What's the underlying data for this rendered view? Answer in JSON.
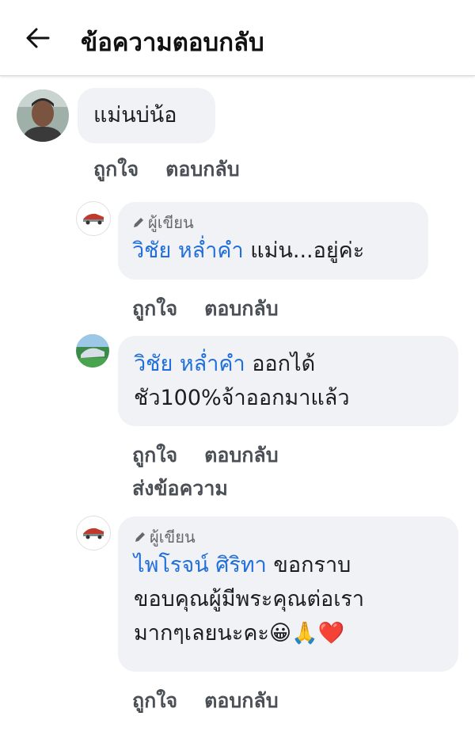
{
  "header": {
    "title": "ข้อความตอบกลับ",
    "back_icon": "arrow-left-icon"
  },
  "comments": [
    {
      "author_tag": "",
      "name": "",
      "text": "แม่นบ่น้อ",
      "actions": [
        "ถูกใจ",
        "ตอบกลับ"
      ]
    },
    {
      "author_tag": "ผู้เขียน",
      "name": "วิชัย หล่ำคำ",
      "text": " แม่น...อยู่ค่ะ",
      "actions": [
        "ถูกใจ",
        "ตอบกลับ"
      ]
    },
    {
      "author_tag": "",
      "name": "วิชัย หล่ำคำ",
      "text_line1": " ออกได้",
      "text_line2": "ชัว100%จ้าออกมาแล้ว",
      "actions": [
        "ถูกใจ",
        "ตอบกลับ"
      ],
      "extra_action": "ส่งข้อความ"
    },
    {
      "author_tag": "ผู้เขียน",
      "name": "ไพโรจน์ ศิริทา",
      "text_line1": " ขอกราบ",
      "text_line2": "ขอบคุณผู้มีพระคุณต่อเรา",
      "text_line3": "มากๆเลยนะคะ",
      "emojis": [
        "😀",
        "🙏",
        "❤️"
      ],
      "actions": [
        "ถูกใจ",
        "ตอบกลับ"
      ]
    }
  ],
  "colors": {
    "name_link": "#216fdb",
    "bubble_bg": "#f0f2f5",
    "action_text": "#4b4f56"
  }
}
